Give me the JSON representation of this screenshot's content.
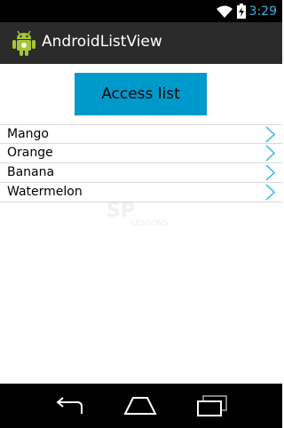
{
  "status_bar": {
    "time": "3:29",
    "icons": [
      "wifi-icon",
      "battery-charging-icon"
    ],
    "accent_color": "#33b5e5"
  },
  "action_bar": {
    "title": "AndroidListView",
    "icon": "android-robot-icon"
  },
  "main": {
    "button_label": "Access list",
    "button_color": "#0099cc",
    "list_items": [
      {
        "label": "Mango"
      },
      {
        "label": "Orange"
      },
      {
        "label": "Banana"
      },
      {
        "label": "Watermelon"
      }
    ],
    "item_icon": "chevron-right-icon",
    "watermark_text": "LESSONS"
  },
  "nav_bar": {
    "buttons": [
      "back-icon",
      "home-icon",
      "recent-apps-icon"
    ]
  }
}
